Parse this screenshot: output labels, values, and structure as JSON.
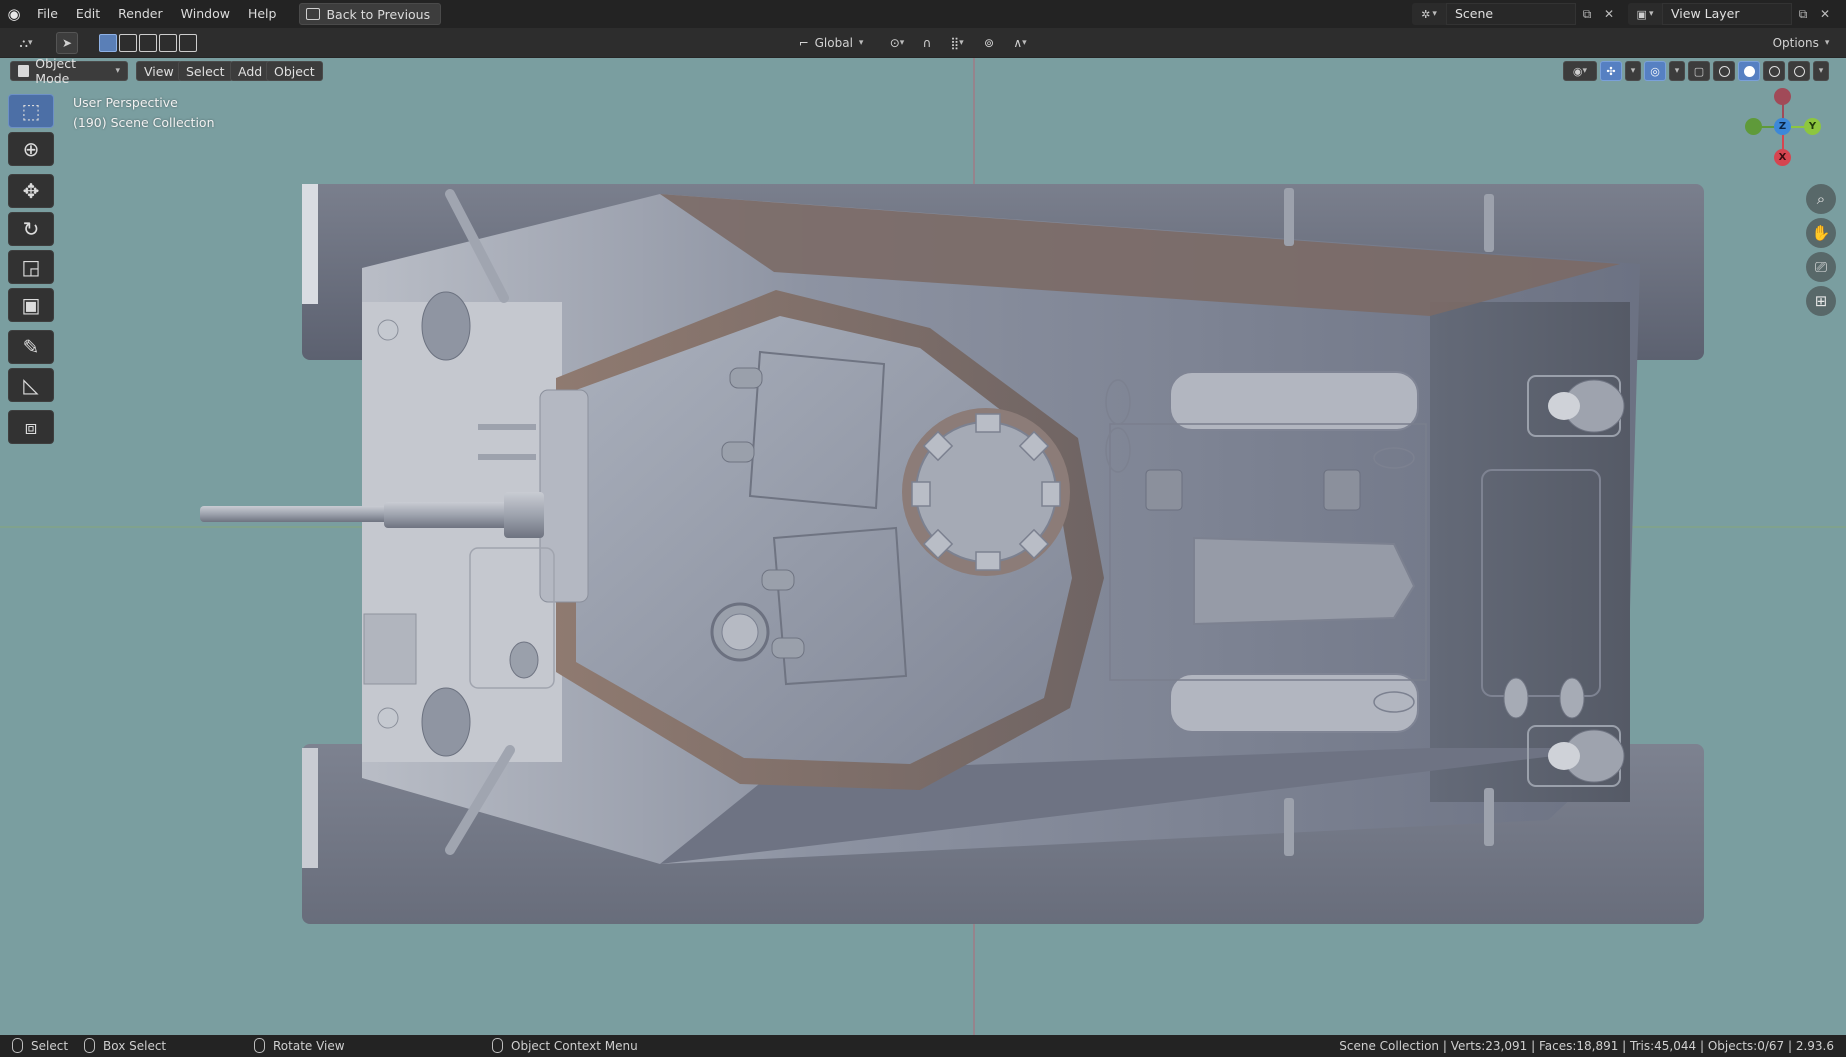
{
  "menubar": {
    "items": [
      "File",
      "Edit",
      "Render",
      "Window",
      "Help"
    ],
    "back_button": "Back to Previous",
    "scene_label": "Scene",
    "view_layer_label": "View Layer"
  },
  "header": {
    "transform_orientation": "Global",
    "options_label": "Options"
  },
  "viewport_header": {
    "mode": "Object Mode",
    "menus": [
      "View",
      "Select",
      "Add",
      "Object"
    ]
  },
  "viewport": {
    "perspective": "User Perspective",
    "collection": "(190) Scene Collection",
    "gizmo_axes": {
      "x": "X",
      "y": "Y",
      "z": "Z"
    },
    "background_color": "#7a9ea0"
  },
  "toolshelf": {
    "tools": [
      "select-box",
      "cursor",
      "move",
      "rotate",
      "scale",
      "transform",
      "annotate",
      "measure",
      "add-cube"
    ]
  },
  "statusbar": {
    "select": "Select",
    "box_select": "Box Select",
    "rotate_view": "Rotate View",
    "context_menu": "Object Context Menu",
    "stats": "Scene Collection | Verts:23,091 | Faces:18,891 | Tris:45,044 | Objects:0/67 | 2.93.6"
  },
  "colors": {
    "accent": "#5680c2",
    "axis_x": "#d64550",
    "axis_y": "#8dc63f",
    "axis_z": "#3d88d8"
  }
}
